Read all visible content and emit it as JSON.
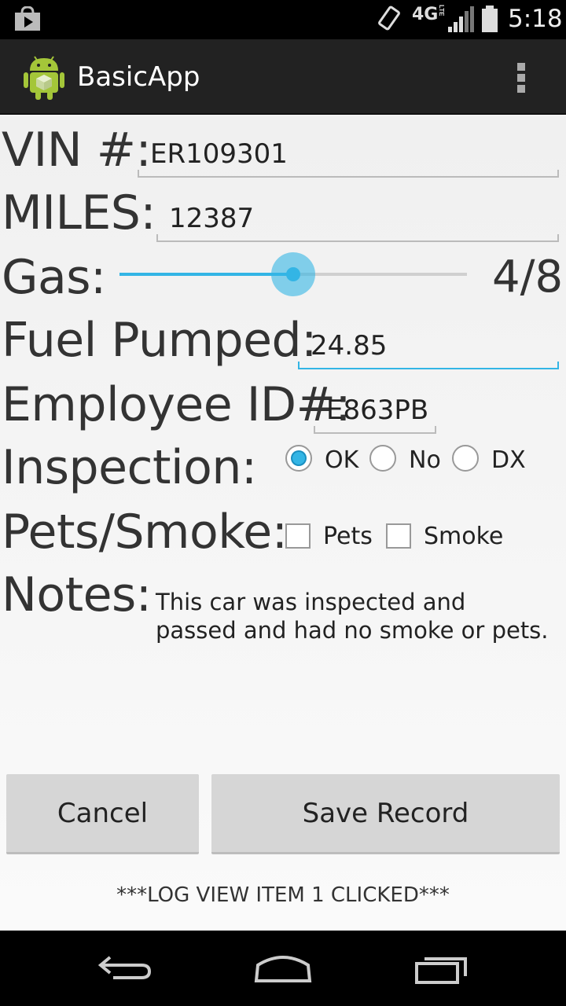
{
  "status_bar": {
    "network": "4G",
    "network_sub": "LTE",
    "time": "5:18"
  },
  "app_bar": {
    "title": "BasicApp"
  },
  "form": {
    "vin_label": "VIN #:",
    "vin_value": "ER109301",
    "miles_label": "MILES:",
    "miles_value": "12387",
    "gas_label": "Gas:",
    "gas_level": 0.5,
    "gas_value_text": "4/8",
    "fuel_label": "Fuel Pumped:",
    "fuel_value": "24.85",
    "employee_label": "Employee ID#:",
    "employee_value": "E863PB",
    "inspection_label": "Inspection:",
    "inspection_options": [
      "OK",
      "No",
      "DX"
    ],
    "inspection_selected": "OK",
    "pets_smoke_label": "Pets/Smoke:",
    "pets_label": "Pets",
    "smoke_label": "Smoke",
    "notes_label": "Notes:",
    "notes_text": "This car was inspected and passed and had no smoke or pets."
  },
  "buttons": {
    "cancel": "Cancel",
    "save": "Save Record"
  },
  "log_text": "***LOG VIEW ITEM 1 CLICKED***",
  "colors": {
    "accent": "#33b5e5",
    "action_bar": "#222222",
    "button": "#d6d6d6"
  }
}
